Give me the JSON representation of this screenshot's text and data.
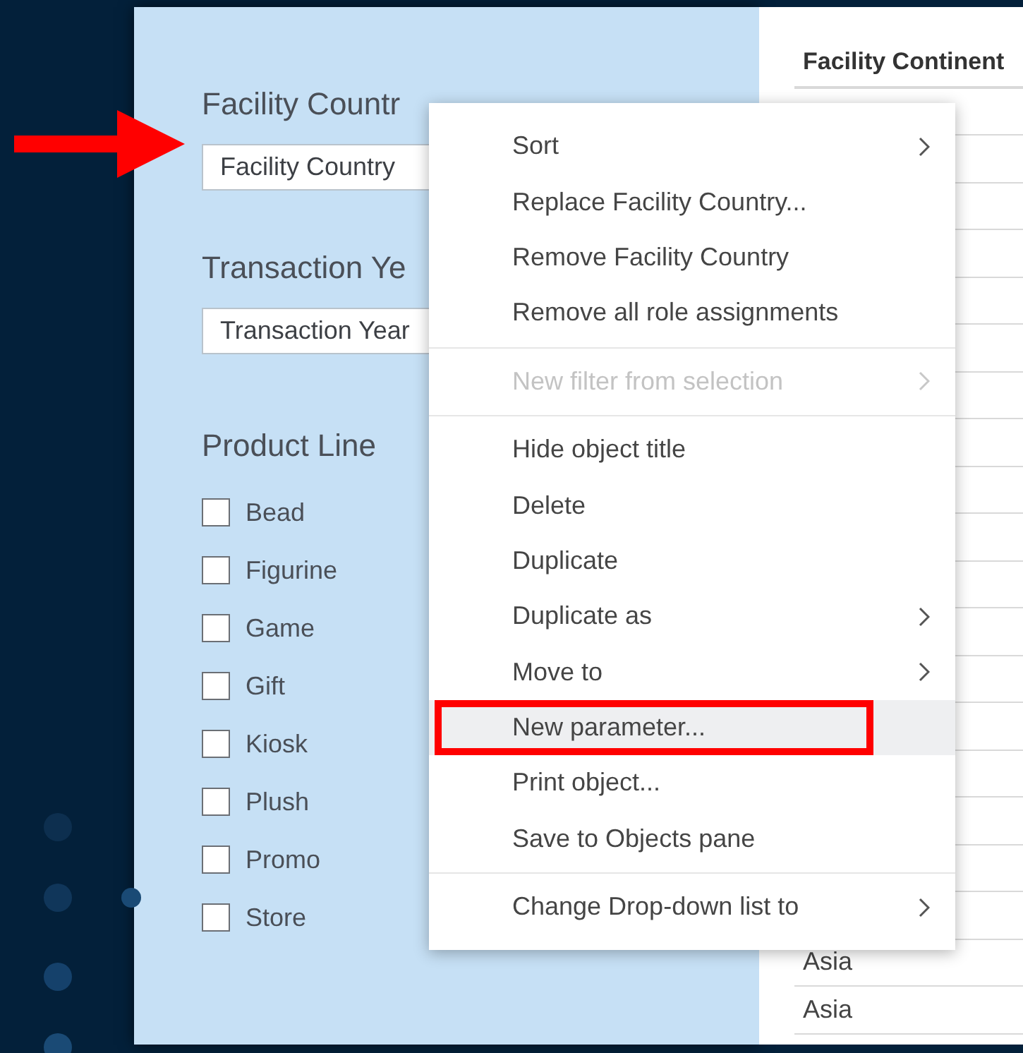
{
  "filters": [
    {
      "title": "Facility Countr",
      "value": "Facility Country"
    },
    {
      "title": "Transaction Ye",
      "value": "Transaction Year"
    }
  ],
  "product_line": {
    "title": "Product Line",
    "items": [
      {
        "label": "Bead",
        "checked": false
      },
      {
        "label": "Figurine",
        "checked": false
      },
      {
        "label": "Game",
        "checked": false
      },
      {
        "label": "Gift",
        "checked": false
      },
      {
        "label": "Kiosk",
        "checked": false
      },
      {
        "label": "Plush",
        "checked": false
      },
      {
        "label": "Promo",
        "checked": false
      },
      {
        "label": "Store",
        "checked": false
      }
    ]
  },
  "table": {
    "columns": [
      "Facility Continent"
    ],
    "rows": [
      "Asia",
      "Asia"
    ]
  },
  "context_menu": {
    "sections": [
      [
        {
          "label": "Sort",
          "submenu": true,
          "disabled": false,
          "selected": false
        },
        {
          "label": "Replace Facility Country...",
          "submenu": false,
          "disabled": false,
          "selected": false
        },
        {
          "label": "Remove Facility Country",
          "submenu": false,
          "disabled": false,
          "selected": false
        },
        {
          "label": "Remove all role assignments",
          "submenu": false,
          "disabled": false,
          "selected": false
        }
      ],
      [
        {
          "label": "New filter from selection",
          "submenu": true,
          "disabled": true,
          "selected": false
        }
      ],
      [
        {
          "label": "Hide object title",
          "submenu": false,
          "disabled": false,
          "selected": false
        },
        {
          "label": "Delete",
          "submenu": false,
          "disabled": false,
          "selected": false
        },
        {
          "label": "Duplicate",
          "submenu": false,
          "disabled": false,
          "selected": false
        },
        {
          "label": "Duplicate as",
          "submenu": true,
          "disabled": false,
          "selected": false
        },
        {
          "label": "Move to",
          "submenu": true,
          "disabled": false,
          "selected": false
        },
        {
          "label": "New parameter...",
          "submenu": false,
          "disabled": false,
          "selected": true
        },
        {
          "label": "Print object...",
          "submenu": false,
          "disabled": false,
          "selected": false
        },
        {
          "label": "Save to Objects pane",
          "submenu": false,
          "disabled": false,
          "selected": false
        }
      ],
      [
        {
          "label": "Change Drop-down list to",
          "submenu": true,
          "disabled": false,
          "selected": false
        }
      ]
    ]
  }
}
